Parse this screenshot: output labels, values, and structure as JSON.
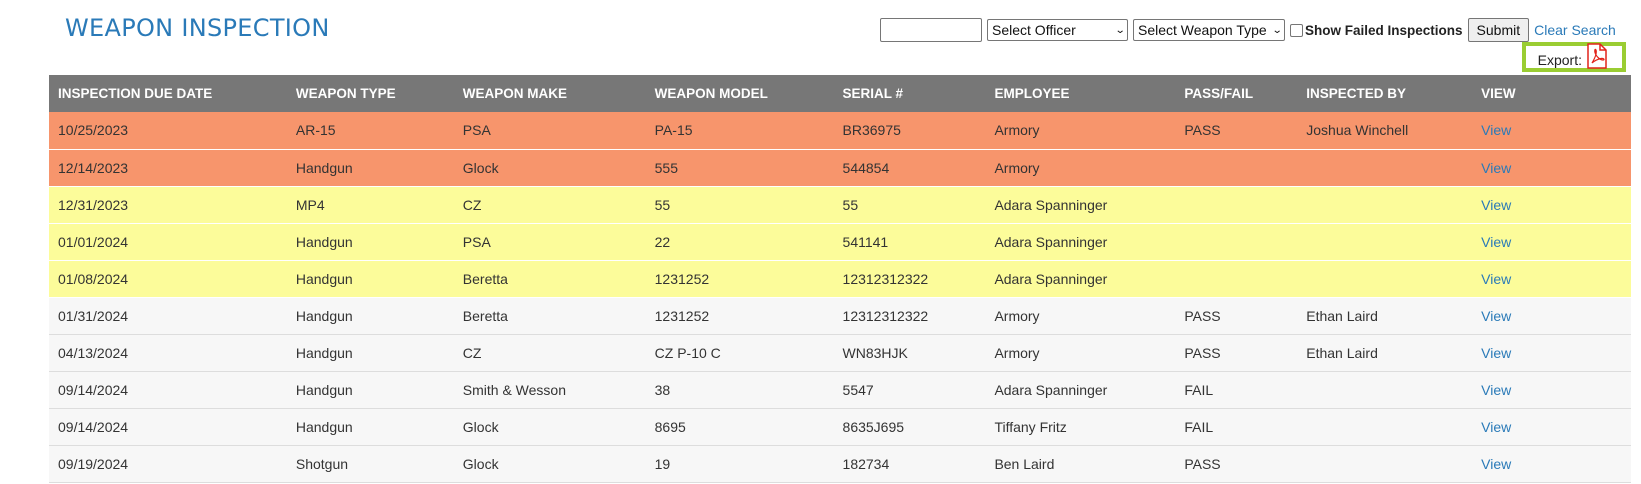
{
  "page": {
    "title": "WEAPON INSPECTION"
  },
  "search": {
    "input_value": "",
    "input_placeholder": "",
    "officer_select": "Select Officer",
    "weapon_type_select": "Select Weapon Type",
    "show_failed_label": "Show Failed Inspections",
    "show_failed_checked": false,
    "submit_label": "Submit",
    "clear_label": "Clear Search"
  },
  "export": {
    "label": "Export:",
    "icon": "pdf-icon"
  },
  "table": {
    "headers": [
      "INSPECTION DUE DATE",
      "WEAPON TYPE",
      "WEAPON MAKE",
      "WEAPON MODEL",
      "SERIAL #",
      "EMPLOYEE",
      "PASS/FAIL",
      "INSPECTED BY",
      "VIEW"
    ],
    "rows": [
      {
        "status": "overdue",
        "cells": [
          "10/25/2023",
          "AR-15",
          "PSA",
          "PA-15",
          "BR36975",
          "Armory",
          "PASS",
          "Joshua Winchell",
          "View"
        ]
      },
      {
        "status": "overdue",
        "cells": [
          "12/14/2023",
          "Handgun",
          "Glock",
          "555",
          "544854",
          "Armory",
          "",
          "",
          "View"
        ]
      },
      {
        "status": "due",
        "cells": [
          "12/31/2023",
          "MP4",
          "CZ",
          "55",
          "55",
          "Adara Spanninger",
          "",
          "",
          "View"
        ]
      },
      {
        "status": "due",
        "cells": [
          "01/01/2024",
          "Handgun",
          "PSA",
          "22",
          "541141",
          "Adara Spanninger",
          "",
          "",
          "View"
        ]
      },
      {
        "status": "due",
        "cells": [
          "01/08/2024",
          "Handgun",
          "Beretta",
          "1231252",
          "12312312322",
          "Adara Spanninger",
          "",
          "",
          "View"
        ]
      },
      {
        "status": "normal",
        "cells": [
          "01/31/2024",
          "Handgun",
          "Beretta",
          "1231252",
          "12312312322",
          "Armory",
          "PASS",
          "Ethan Laird",
          "View"
        ]
      },
      {
        "status": "normal",
        "cells": [
          "04/13/2024",
          "Handgun",
          "CZ",
          "CZ P-10 C",
          "WN83HJK",
          "Armory",
          "PASS",
          "Ethan Laird",
          "View"
        ]
      },
      {
        "status": "normal",
        "cells": [
          "09/14/2024",
          "Handgun",
          "Smith & Wesson",
          "38",
          "5547",
          "Adara Spanninger",
          "FAIL",
          "",
          "View"
        ]
      },
      {
        "status": "normal",
        "cells": [
          "09/14/2024",
          "Handgun",
          "Glock",
          "8695",
          "8635J695",
          "Tiffany Fritz",
          "FAIL",
          "",
          "View"
        ]
      },
      {
        "status": "normal",
        "cells": [
          "09/19/2024",
          "Shotgun",
          "Glock",
          "19",
          "182734",
          "Ben Laird",
          "PASS",
          "",
          "View"
        ]
      }
    ]
  },
  "colors": {
    "title": "#2a7ab8",
    "header_bg": "#777777",
    "overdue_row": "#f7956c",
    "due_row": "#fcfc9a",
    "normal_row": "#f7f7f7",
    "export_highlight": "#9acd32",
    "link": "#2a7ab8"
  }
}
